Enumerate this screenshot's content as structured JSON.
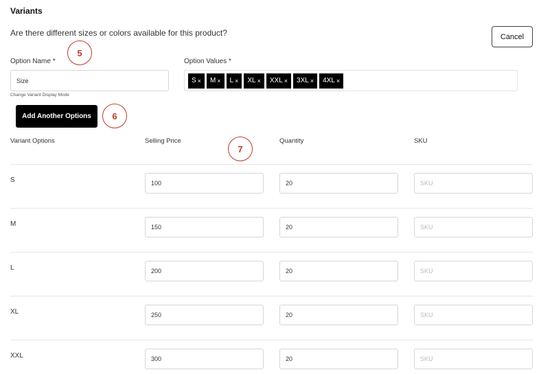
{
  "section": {
    "title": "Variants",
    "question": "Are there different sizes or colors available for this product?",
    "cancel_label": "Cancel"
  },
  "option_name": {
    "label": "Option Name *",
    "value": "Size",
    "hint": "Change Variant Display Mode"
  },
  "option_values": {
    "label": "Option Values *",
    "chips": [
      "S",
      "M",
      "L",
      "XL",
      "XXL",
      "3XL",
      "4XL"
    ],
    "remove_glyph": "×"
  },
  "add_options_label": "Add Another Options",
  "annotations": [
    "5",
    "6",
    "7"
  ],
  "annotation_color": "#c0392b",
  "table": {
    "headers": [
      "Variant Options",
      "Selling Price",
      "Quantity",
      "SKU"
    ],
    "sku_placeholder": "SKU",
    "rows": [
      {
        "variant": "S",
        "price": "100",
        "quantity": "20"
      },
      {
        "variant": "M",
        "price": "150",
        "quantity": "20"
      },
      {
        "variant": "L",
        "price": "200",
        "quantity": "20"
      },
      {
        "variant": "XL",
        "price": "250",
        "quantity": "20"
      },
      {
        "variant": "XXL",
        "price": "300",
        "quantity": "20"
      }
    ]
  }
}
